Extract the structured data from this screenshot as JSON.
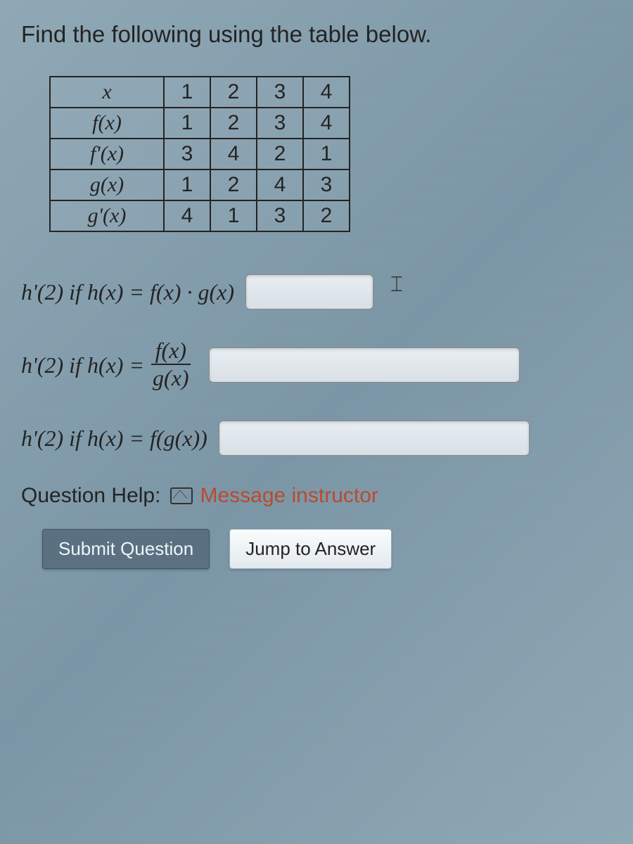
{
  "prompt": "Find the following using the table below.",
  "table": {
    "rows": [
      {
        "label": "x",
        "cells": [
          "1",
          "2",
          "3",
          "4"
        ]
      },
      {
        "label": "f(x)",
        "cells": [
          "1",
          "2",
          "3",
          "4"
        ]
      },
      {
        "label": "f'(x)",
        "cells": [
          "3",
          "4",
          "2",
          "1"
        ]
      },
      {
        "label": "g(x)",
        "cells": [
          "1",
          "2",
          "4",
          "3"
        ]
      },
      {
        "label": "g'(x)",
        "cells": [
          "4",
          "1",
          "3",
          "2"
        ]
      }
    ]
  },
  "questions": {
    "q1_prefix": "h'(2) if h(x) = f(x) · g(x)",
    "q2_prefix": "h'(2) if h(x) = ",
    "q2_frac_num": "f(x)",
    "q2_frac_den": "g(x)",
    "q3_prefix": "h'(2) if h(x) = f(g(x))"
  },
  "help": {
    "label": "Question Help:",
    "link": "Message instructor"
  },
  "buttons": {
    "submit": "Submit Question",
    "jump": "Jump to Answer"
  }
}
